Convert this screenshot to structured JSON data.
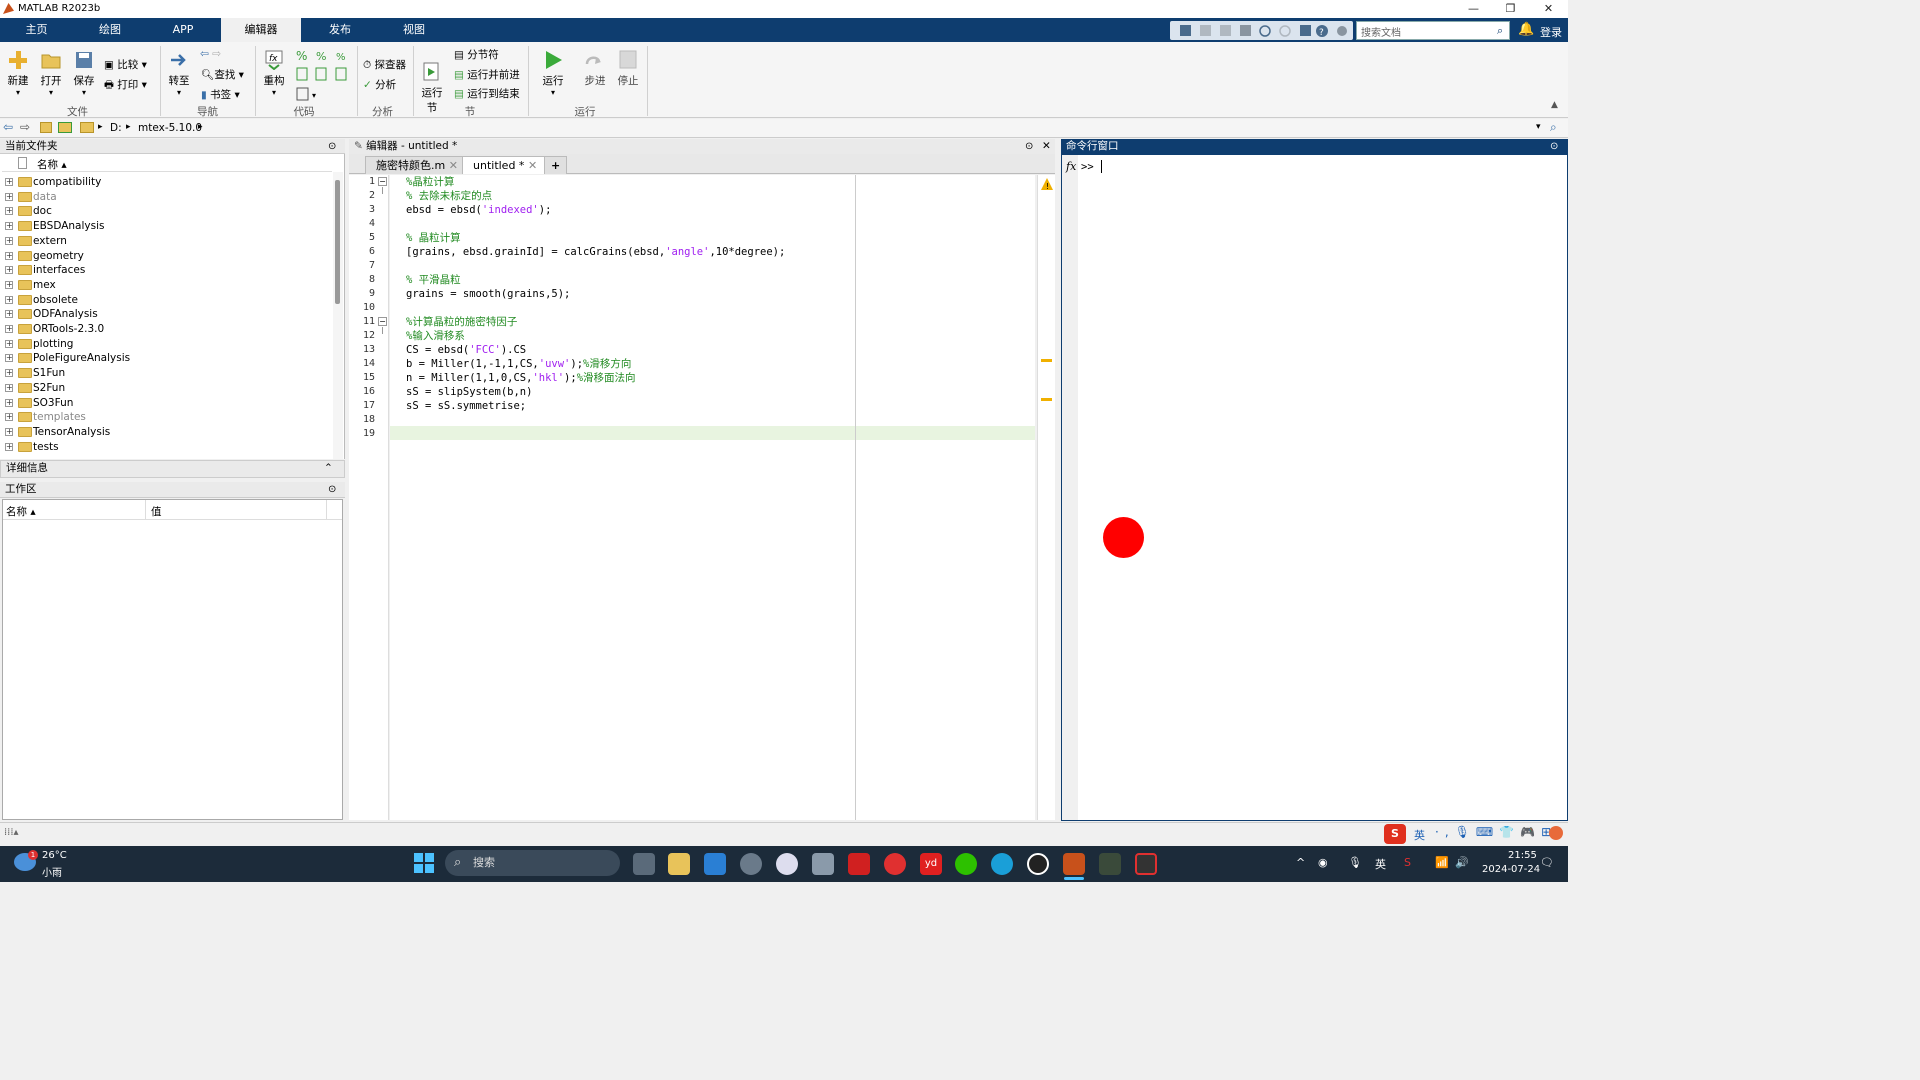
{
  "window": {
    "title": "MATLAB R2023b",
    "minimize": "—",
    "restore": "❐",
    "close": "✕"
  },
  "tabs": [
    {
      "label": "主页"
    },
    {
      "label": "绘图"
    },
    {
      "label": "APP"
    },
    {
      "label": "编辑器"
    },
    {
      "label": "发布"
    },
    {
      "label": "视图"
    }
  ],
  "search": {
    "placeholder": "搜索文档",
    "login": "登录"
  },
  "ribbon": {
    "file": {
      "new": "新建",
      "open": "打开",
      "save": "保存",
      "compare": "比较",
      "print": "打印",
      "group": "文件"
    },
    "nav": {
      "goto": "转至",
      "find": "查找",
      "bookmark": "书签",
      "group": "导航"
    },
    "code": {
      "refactor": "重构",
      "group": "代码"
    },
    "analyze": {
      "profiler": "探查器",
      "analyze": "分析",
      "group": "分析"
    },
    "section": {
      "run_section": "运行\n节",
      "section_break": "分节符",
      "run_advance": "运行并前进",
      "run_to_end": "运行到结束",
      "group": "节"
    },
    "run": {
      "run": "运行",
      "step": "步进",
      "stop": "停止",
      "group": "运行"
    }
  },
  "address": {
    "drive": "D:",
    "folder": "mtex-5.10.0"
  },
  "current_folder": {
    "title": "当前文件夹",
    "col_name": "名称 ▴",
    "items": [
      {
        "name": "compatibility",
        "dim": false
      },
      {
        "name": "data",
        "dim": true
      },
      {
        "name": "doc",
        "dim": false
      },
      {
        "name": "EBSDAnalysis",
        "dim": false
      },
      {
        "name": "extern",
        "dim": false
      },
      {
        "name": "geometry",
        "dim": false
      },
      {
        "name": "interfaces",
        "dim": false
      },
      {
        "name": "mex",
        "dim": false
      },
      {
        "name": "obsolete",
        "dim": false
      },
      {
        "name": "ODFAnalysis",
        "dim": false
      },
      {
        "name": "ORTools-2.3.0",
        "dim": false
      },
      {
        "name": "plotting",
        "dim": false
      },
      {
        "name": "PoleFigureAnalysis",
        "dim": false
      },
      {
        "name": "S1Fun",
        "dim": false
      },
      {
        "name": "S2Fun",
        "dim": false
      },
      {
        "name": "SO3Fun",
        "dim": false
      },
      {
        "name": "templates",
        "dim": true
      },
      {
        "name": "TensorAnalysis",
        "dim": false
      },
      {
        "name": "tests",
        "dim": false
      }
    ]
  },
  "details": {
    "title": "详细信息"
  },
  "workspace": {
    "title": "工作区",
    "col_name": "名称 ▴",
    "col_value": "值"
  },
  "editor": {
    "title": "编辑器 - untitled *",
    "tabs": [
      {
        "label": "施密特颜色.m"
      },
      {
        "label": "untitled *"
      }
    ],
    "add_tab": "+",
    "lines": [
      {
        "n": "1",
        "text": "%晶粒计算",
        "cls": "cm"
      },
      {
        "n": "2",
        "text": "% 去除未标定的点",
        "cls": "cm"
      },
      {
        "n": "3",
        "text": "ebsd = ebsd('indexed');",
        "cls": ""
      },
      {
        "n": "4",
        "text": "",
        "cls": ""
      },
      {
        "n": "5",
        "text": "% 晶粒计算",
        "cls": "cm"
      },
      {
        "n": "6",
        "text": "[grains, ebsd.grainId] = calcGrains(ebsd,'angle',10*degree);",
        "cls": ""
      },
      {
        "n": "7",
        "text": "",
        "cls": ""
      },
      {
        "n": "8",
        "text": "% 平滑晶粒",
        "cls": "cm"
      },
      {
        "n": "9",
        "text": "grains = smooth(grains,5);",
        "cls": ""
      },
      {
        "n": "10",
        "text": "",
        "cls": ""
      },
      {
        "n": "11",
        "text": "%计算晶粒的施密特因子",
        "cls": "cm"
      },
      {
        "n": "12",
        "text": "%输入滑移系",
        "cls": "cm"
      },
      {
        "n": "13",
        "text": "CS = ebsd('FCC').CS",
        "cls": ""
      },
      {
        "n": "14",
        "text": "b = Miller(1,-1,1,CS,'uvw');%滑移方向",
        "cls": ""
      },
      {
        "n": "15",
        "text": "n = Miller(1,1,0,CS,'hkl');%滑移面法向",
        "cls": ""
      },
      {
        "n": "16",
        "text": "sS = slipSystem(b,n)",
        "cls": ""
      },
      {
        "n": "17",
        "text": "sS = sS.symmetrise;",
        "cls": ""
      },
      {
        "n": "18",
        "text": "",
        "cls": ""
      },
      {
        "n": "19",
        "text": "",
        "cls": ""
      }
    ]
  },
  "command_window": {
    "title": "命令行窗口",
    "prompt": ">>",
    "fx": "fx"
  },
  "taskbar": {
    "weather_temp": "26°C",
    "weather_desc": "小雨",
    "search": "搜索",
    "ime": "英",
    "time": "21:55",
    "date": "2024-07-24"
  },
  "colors": {
    "accent": "#0e3d6f",
    "comment": "#228b22",
    "string": "#a020f0"
  }
}
